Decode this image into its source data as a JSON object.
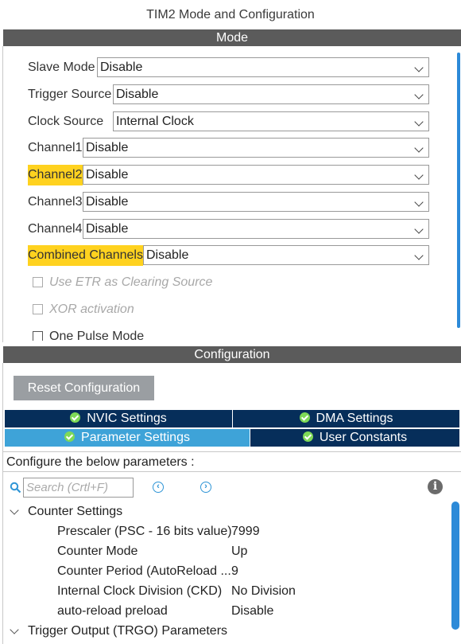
{
  "window": {
    "title": "TIM2 Mode and Configuration"
  },
  "mode": {
    "header": "Mode",
    "fields": [
      {
        "label": "Slave Mode",
        "value": "Disable",
        "highlight": false
      },
      {
        "label": "Trigger Source",
        "value": "Disable",
        "highlight": false
      },
      {
        "label": "Clock Source",
        "value": "Internal Clock",
        "highlight": false
      },
      {
        "label": "Channel1",
        "value": "Disable",
        "highlight": false
      },
      {
        "label": "Channel2",
        "value": "Disable",
        "highlight": true
      },
      {
        "label": "Channel3",
        "value": "Disable",
        "highlight": false
      },
      {
        "label": "Channel4",
        "value": "Disable",
        "highlight": false
      },
      {
        "label": "Combined Channels",
        "value": "Disable",
        "highlight": true
      }
    ],
    "checkboxes": [
      {
        "label": "Use ETR as Clearing Source",
        "enabled": false,
        "checked": false
      },
      {
        "label": "XOR activation",
        "enabled": false,
        "checked": false
      },
      {
        "label": "One Pulse Mode",
        "enabled": true,
        "checked": false
      }
    ],
    "highlight_color": "#ffd21f"
  },
  "configuration": {
    "header": "Configuration",
    "reset_button": "Reset Configuration",
    "tabs": [
      {
        "label": "NVIC Settings",
        "active": false
      },
      {
        "label": "DMA Settings",
        "active": false
      },
      {
        "label": "Parameter Settings",
        "active": true
      },
      {
        "label": "User Constants",
        "active": false
      }
    ],
    "tab_colors": {
      "inactive": "#062e5a",
      "active": "#3ea3d8",
      "tick": "#7ed957"
    },
    "instruction": "Configure the below parameters :",
    "search": {
      "placeholder": "Search (Crtl+F)",
      "icon": "search-icon"
    },
    "nav_icons": [
      "previous-icon",
      "next-icon",
      "info-icon"
    ],
    "tree": {
      "group1": {
        "name": "Counter Settings",
        "items": [
          {
            "name": "Prescaler (PSC - 16 bits value)",
            "value": "7999"
          },
          {
            "name": "Counter Mode",
            "value": "Up"
          },
          {
            "name": "Counter Period (AutoReload ...",
            "value": "9"
          },
          {
            "name": "Internal Clock Division (CKD)",
            "value": "No Division"
          },
          {
            "name": "auto-reload preload",
            "value": "Disable"
          }
        ]
      },
      "group2": {
        "name": "Trigger Output (TRGO) Parameters"
      }
    }
  }
}
